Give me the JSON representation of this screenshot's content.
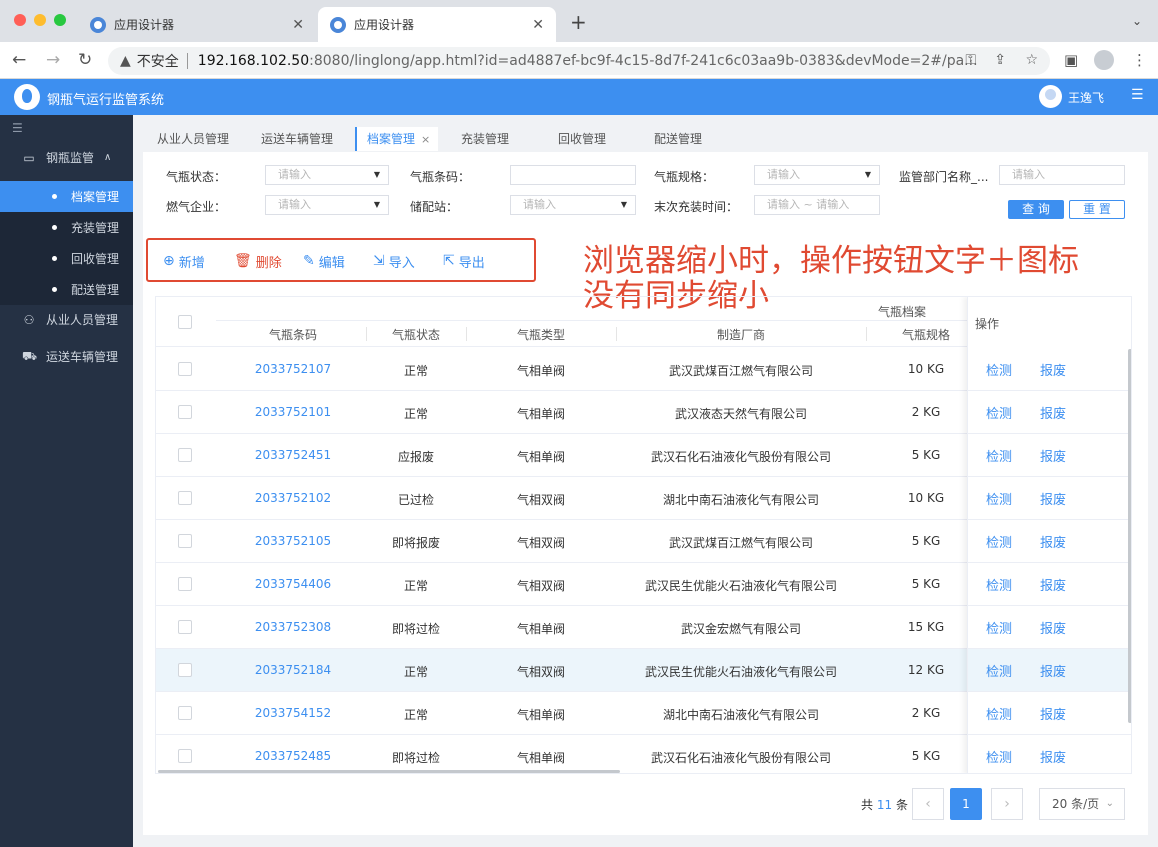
{
  "browser": {
    "tabs": [
      {
        "title": "应用设计器",
        "close": "✕"
      },
      {
        "title": "应用设计器",
        "close": "✕"
      }
    ],
    "new_tab": "+",
    "tab_menu": "⌄",
    "insecure_label": "不安全",
    "url_host": "192.168.102.50",
    "url_rest": ":8080/linglong/app.html?id=ad4887ef-bc9f-4c15-8d7f-241c6c03aa9b-0383&devMode=2#/pa..."
  },
  "header": {
    "title": "钢瓶气运行监管系统",
    "user": "王逸飞"
  },
  "sidebar": {
    "collapse": "☰",
    "group": {
      "label": "钢瓶监管",
      "caret": "∧"
    },
    "subs": [
      "档案管理",
      "充装管理",
      "回收管理",
      "配送管理"
    ],
    "items": [
      "从业人员管理",
      "运送车辆管理"
    ]
  },
  "page_tabs": [
    {
      "label": "从业人员管理"
    },
    {
      "label": "运送车辆管理"
    },
    {
      "label": "档案管理",
      "close": "×"
    },
    {
      "label": "充装管理"
    },
    {
      "label": "回收管理"
    },
    {
      "label": "配送管理"
    }
  ],
  "filters": {
    "status_label": "气瓶状态：",
    "status_ph": "请输入",
    "code_label": "气瓶条码：",
    "spec_label": "气瓶规格：",
    "spec_ph": "请输入",
    "dept_label": "监管部门名称_...",
    "dept_ph": "请输入",
    "company_label": "燃气企业：",
    "company_ph": "请输入",
    "station_label": "储配站：",
    "station_ph": "请输入",
    "last_fill_label": "末次充装时间：",
    "last_fill_ph": "请输入 ~ 请输入",
    "query": "查 询",
    "reset": "重 置"
  },
  "toolbar": {
    "add": "新增",
    "delete": "删除",
    "edit": "编辑",
    "import": "导入",
    "export": "导出"
  },
  "annotation": {
    "line1": "浏览器缩小时，操作按钮文字＋图标",
    "line2": "没有同步缩小"
  },
  "table": {
    "group_header": "气瓶档案",
    "columns": [
      "气瓶条码",
      "气瓶状态",
      "气瓶类型",
      "制造厂商",
      "气瓶规格"
    ],
    "op_header": "操作",
    "op_detect": "检测",
    "op_scrap": "报废",
    "rows": [
      {
        "code": "2033752107",
        "status": "正常",
        "type": "气相单阀",
        "maker": "武汉武煤百江燃气有限公司",
        "spec": "10 KG"
      },
      {
        "code": "2033752101",
        "status": "正常",
        "type": "气相单阀",
        "maker": "武汉液态天然气有限公司",
        "spec": "2 KG"
      },
      {
        "code": "2033752451",
        "status": "应报废",
        "type": "气相单阀",
        "maker": "武汉石化石油液化气股份有限公司",
        "spec": "5 KG"
      },
      {
        "code": "2033752102",
        "status": "已过检",
        "type": "气相双阀",
        "maker": "湖北中南石油液化气有限公司",
        "spec": "10 KG"
      },
      {
        "code": "2033752105",
        "status": "即将报废",
        "type": "气相双阀",
        "maker": "武汉武煤百江燃气有限公司",
        "spec": "5 KG"
      },
      {
        "code": "2033754406",
        "status": "正常",
        "type": "气相双阀",
        "maker": "武汉民生优能火石油液化气有限公司",
        "spec": "5 KG"
      },
      {
        "code": "2033752308",
        "status": "即将过检",
        "type": "气相单阀",
        "maker": "武汉金宏燃气有限公司",
        "spec": "15 KG"
      },
      {
        "code": "2033752184",
        "status": "正常",
        "type": "气相双阀",
        "maker": "武汉民生优能火石油液化气有限公司",
        "spec": "12 KG"
      },
      {
        "code": "2033754152",
        "status": "正常",
        "type": "气相单阀",
        "maker": "湖北中南石油液化气有限公司",
        "spec": "2 KG"
      },
      {
        "code": "2033752485",
        "status": "即将过检",
        "type": "气相单阀",
        "maker": "武汉石化石油液化气股份有限公司",
        "spec": "5 KG"
      }
    ]
  },
  "pagination": {
    "total_prefix": "共",
    "total": "11",
    "total_suffix": "条",
    "prev": "‹",
    "page": "1",
    "next": "›",
    "page_size": "20 条/页"
  }
}
